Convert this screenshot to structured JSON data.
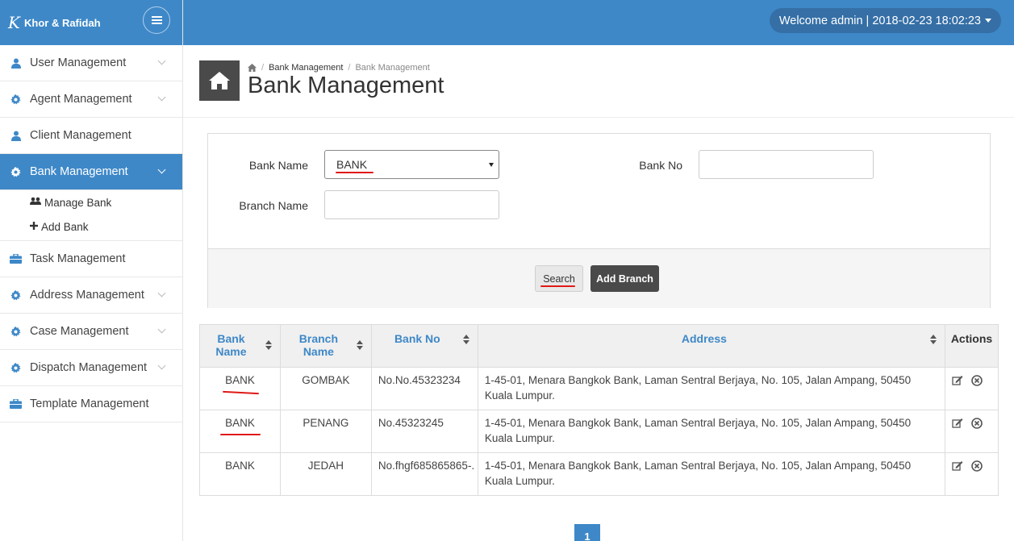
{
  "brand": {
    "name": "Khor & Rafidah",
    "logo_text": "K"
  },
  "topbar": {
    "welcome": "Welcome admin | 2018-02-23 18:02:23"
  },
  "sidebar": {
    "items": [
      {
        "label": "User Management",
        "icon": "user-icon"
      },
      {
        "label": "Agent Management",
        "icon": "gear-icon"
      },
      {
        "label": "Client Management",
        "icon": "user-icon"
      },
      {
        "label": "Bank Management",
        "icon": "gear-icon",
        "active": true
      },
      {
        "label": "Task Management",
        "icon": "briefcase-icon"
      },
      {
        "label": "Address Management",
        "icon": "gear-icon"
      },
      {
        "label": "Case Management",
        "icon": "gear-icon"
      },
      {
        "label": "Dispatch Management",
        "icon": "gear-icon"
      },
      {
        "label": "Template Management",
        "icon": "briefcase-icon"
      }
    ],
    "submenu": [
      {
        "label": "Manage Bank",
        "icon": "users-icon"
      },
      {
        "label": "Add Bank",
        "icon": "plus-icon"
      }
    ]
  },
  "breadcrumb": {
    "parent": "Bank Management",
    "current": "Bank Management"
  },
  "page": {
    "title": "Bank Management"
  },
  "form": {
    "bank_name_label": "Bank Name",
    "bank_name_value": "BANK",
    "bank_no_label": "Bank No",
    "bank_no_value": "",
    "branch_name_label": "Branch Name",
    "branch_name_value": "",
    "search_label": "Search",
    "add_branch_label": "Add Branch"
  },
  "table": {
    "headers": {
      "bank_name_1": "Bank",
      "bank_name_2": "Name",
      "branch_name_1": "Branch",
      "branch_name_2": "Name",
      "bank_no": "Bank No",
      "address": "Address",
      "actions": "Actions"
    },
    "rows": [
      {
        "bank": "BANK",
        "branch": "GOMBAK",
        "bank_no": "No.No.45323234",
        "address": "1-45-01, Menara Bangkok Bank, Laman Sentral Berjaya, No. 105, Jalan Ampang, 50450 Kuala Lumpur."
      },
      {
        "bank": "BANK",
        "branch": "PENANG",
        "bank_no": "No.45323245",
        "address": "1-45-01, Menara Bangkok Bank, Laman Sentral Berjaya, No. 105, Jalan Ampang, 50450 Kuala Lumpur."
      },
      {
        "bank": "BANK",
        "branch": "JEDAH",
        "bank_no": "No.fhgf685865865-.",
        "address": "1-45-01, Menara Bangkok Bank, Laman Sentral Berjaya, No. 105, Jalan Ampang, 50450 Kuala Lumpur."
      }
    ]
  },
  "pagination": {
    "current": "1"
  },
  "colors": {
    "primary": "#3e88c8",
    "dark": "#4a4a4a",
    "annotation": "#e01818"
  }
}
